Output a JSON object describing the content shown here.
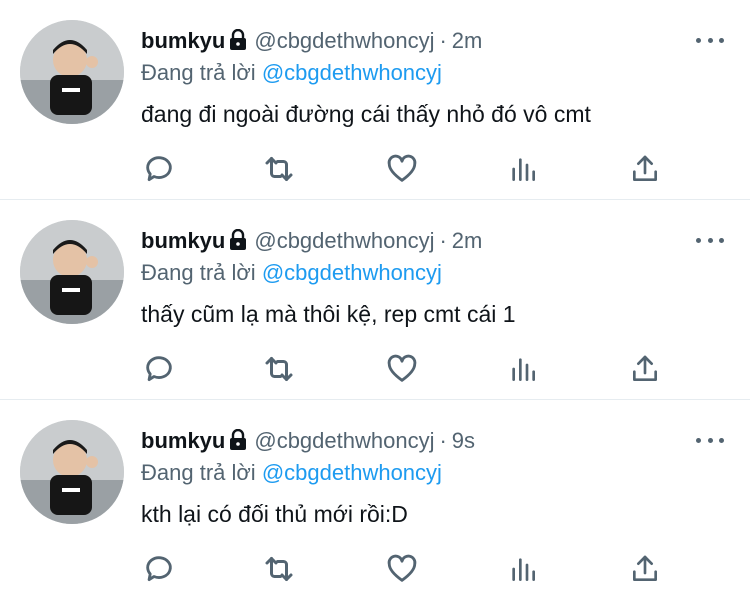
{
  "tweets": [
    {
      "name": "bumkyu",
      "handle": "@cbgdethwhoncyj",
      "separator": "·",
      "time": "2m",
      "reply_prefix": "Đang trả lời",
      "reply_to": "@cbgdethwhoncyj",
      "text": "đang đi ngoài đường cái thấy nhỏ đó vô cmt"
    },
    {
      "name": "bumkyu",
      "handle": "@cbgdethwhoncyj",
      "separator": "·",
      "time": "2m",
      "reply_prefix": "Đang trả lời",
      "reply_to": "@cbgdethwhoncyj",
      "text": "thấy cũm lạ mà thôi kệ, rep cmt cái 1"
    },
    {
      "name": "bumkyu",
      "handle": "@cbgdethwhoncyj",
      "separator": "·",
      "time": "9s",
      "reply_prefix": "Đang trả lời",
      "reply_to": "@cbgdethwhoncyj",
      "text": "kth lại có đối thủ mới rồi:D"
    }
  ],
  "icons": {
    "avatar": "avatar-photo",
    "lock": "lock-icon",
    "more": "more-icon",
    "reply": "reply-icon",
    "retweet": "retweet-icon",
    "like": "heart-icon",
    "analytics": "analytics-icon",
    "share": "share-icon"
  },
  "colors": {
    "text": "#0f1419",
    "secondary": "#536471",
    "mention": "#1d9bf0",
    "divider": "#e6ecf0"
  }
}
